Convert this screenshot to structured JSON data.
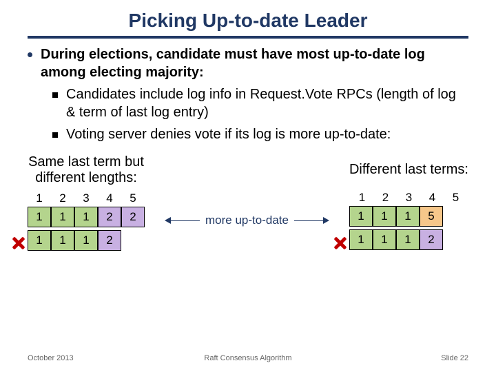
{
  "title": "Picking Up-to-date Leader",
  "bullet_main": "During elections, candidate must have most up-to-date log among electing majority:",
  "sub1": "Candidates include log info in Request.Vote RPCs (length of log & term of last log entry)",
  "sub2": "Voting server denies vote if its log is more up-to-date:",
  "left_caption_l1": "Same last term but",
  "left_caption_l2": "different lengths:",
  "right_caption": "Different last terms:",
  "center_label": "more up-to-date",
  "idx": [
    "1",
    "2",
    "3",
    "4",
    "5"
  ],
  "left_rows": [
    [
      "1",
      "1",
      "1",
      "2",
      "2"
    ],
    [
      "1",
      "1",
      "1",
      "2"
    ]
  ],
  "right_rows": [
    [
      "1",
      "1",
      "1",
      "5"
    ],
    [
      "1",
      "1",
      "1",
      "2"
    ]
  ],
  "footer_left": "October 2013",
  "footer_mid": "Raft Consensus Algorithm",
  "footer_right": "Slide 22",
  "chart_data": {
    "type": "table",
    "title": "Log comparison for leader election",
    "left": {
      "caption": "Same last term but different lengths",
      "indices": [
        1,
        2,
        3,
        4,
        5
      ],
      "logs": [
        {
          "entries": [
            1,
            1,
            1,
            2,
            2
          ],
          "more_up_to_date": true
        },
        {
          "entries": [
            1,
            1,
            1,
            2
          ],
          "more_up_to_date": false
        }
      ]
    },
    "right": {
      "caption": "Different last terms",
      "indices": [
        1,
        2,
        3,
        4,
        5
      ],
      "logs": [
        {
          "entries": [
            1,
            1,
            1,
            5
          ],
          "more_up_to_date": true
        },
        {
          "entries": [
            1,
            1,
            1,
            2
          ],
          "more_up_to_date": false
        }
      ]
    }
  }
}
